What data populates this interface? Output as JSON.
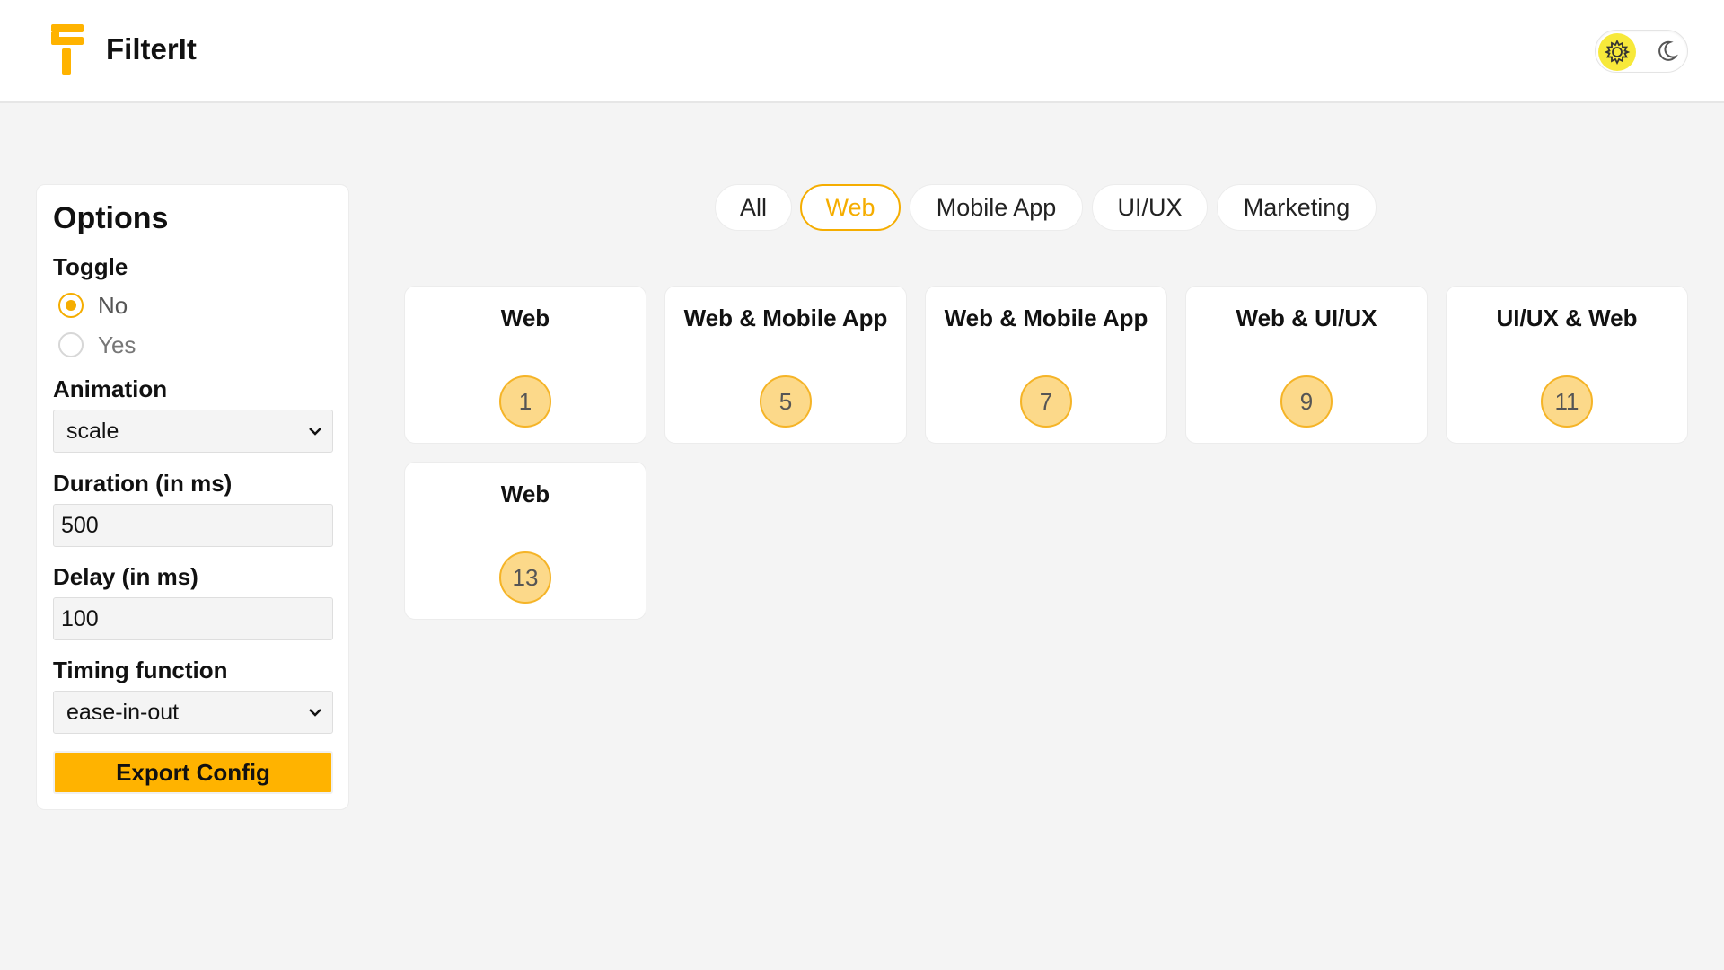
{
  "header": {
    "brand": "FilterIt",
    "logo_icon": "filter-logo-icon",
    "theme": {
      "light_icon": "gear-sun-icon",
      "dark_icon": "moon-icon",
      "active": "light"
    }
  },
  "options": {
    "title": "Options",
    "toggle": {
      "label": "Toggle",
      "choices": [
        {
          "label": "No",
          "checked": true
        },
        {
          "label": "Yes",
          "checked": false
        }
      ]
    },
    "animation": {
      "label": "Animation",
      "value": "scale"
    },
    "duration": {
      "label": "Duration (in ms)",
      "value": "500"
    },
    "delay": {
      "label": "Delay (in ms)",
      "value": "100"
    },
    "timing": {
      "label": "Timing function",
      "value": "ease-in-out"
    },
    "export_label": "Export Config"
  },
  "tabs": [
    {
      "label": "All",
      "active": false
    },
    {
      "label": "Web",
      "active": true
    },
    {
      "label": "Mobile App",
      "active": false
    },
    {
      "label": "UI/UX",
      "active": false
    },
    {
      "label": "Marketing",
      "active": false
    }
  ],
  "cards": [
    {
      "title": "Web",
      "number": "1"
    },
    {
      "title": "Web & Mobile App",
      "number": "5"
    },
    {
      "title": "Web & Mobile App",
      "number": "7"
    },
    {
      "title": "Web & UI/UX",
      "number": "9"
    },
    {
      "title": "UI/UX & Web",
      "number": "11"
    },
    {
      "title": "Web",
      "number": "13"
    }
  ],
  "colors": {
    "accent": "#ffb300",
    "accent_text": "#f5ad00",
    "badge_fill": "#fcd98a",
    "background": "#f4f4f4",
    "sun_bg": "#f7e93a"
  }
}
